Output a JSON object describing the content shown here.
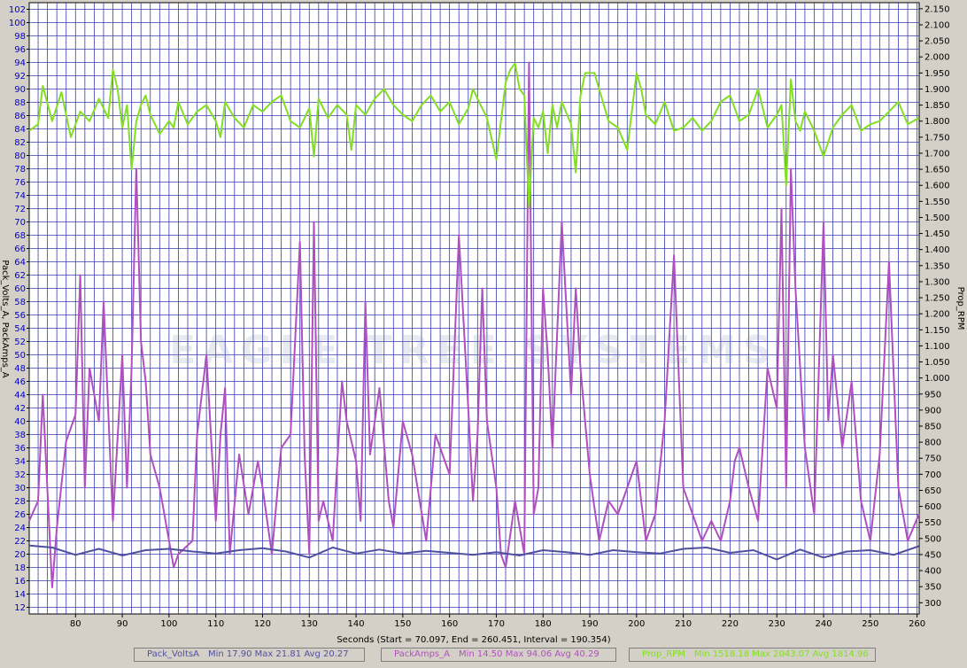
{
  "chart_data": {
    "type": "line",
    "xlabel": "Seconds (Start = 70.097,  End = 260.451,  Interval = 190.354)",
    "xlim": [
      70.097,
      260.451
    ],
    "x_ticks": [
      80,
      90,
      100,
      110,
      120,
      130,
      140,
      150,
      160,
      170,
      180,
      190,
      200,
      210,
      220,
      230,
      240,
      250,
      260
    ],
    "y_left": {
      "label": "Pack_Volts_A, PackAmps_A",
      "ylim": [
        11,
        103
      ],
      "ticks": [
        12,
        14,
        16,
        18,
        20,
        22,
        24,
        26,
        28,
        30,
        32,
        34,
        36,
        38,
        40,
        42,
        44,
        46,
        48,
        50,
        52,
        54,
        56,
        58,
        60,
        62,
        64,
        66,
        68,
        70,
        72,
        74,
        76,
        78,
        80,
        82,
        84,
        86,
        88,
        90,
        92,
        94,
        96,
        98,
        100,
        102
      ]
    },
    "y_right": {
      "label": "Prop_RPM",
      "ylim": [
        265,
        2169
      ],
      "ticks": [
        "300",
        "350",
        "400",
        "450",
        "500",
        "550",
        "600",
        "650",
        "700",
        "750",
        "800",
        "850",
        "900",
        "950",
        "1.000",
        "1.050",
        "1.100",
        "1.150",
        "1.200",
        "1.250",
        "1.300",
        "1.350",
        "1.400",
        "1.450",
        "1.500",
        "1.550",
        "1.600",
        "1.650",
        "1.700",
        "1.750",
        "1.800",
        "1.850",
        "1.900",
        "1.950",
        "2.000",
        "2.050",
        "2.100",
        "2.150"
      ]
    },
    "grid": true,
    "watermark": "EAGLE TREE SYSTEMS",
    "series": [
      {
        "name": "Pack_VoltsA",
        "axis": "left",
        "color": "#5050a0",
        "x": [
          70.1,
          75,
          80,
          85,
          90,
          95,
          100,
          105,
          110,
          115,
          120,
          125,
          130,
          135,
          140,
          145,
          150,
          155,
          160,
          165,
          170,
          175,
          180,
          185,
          190,
          195,
          200,
          205,
          210,
          215,
          220,
          225,
          230,
          235,
          240,
          245,
          250,
          255,
          260.4
        ],
        "y": [
          21.3,
          21.0,
          19.9,
          20.8,
          19.8,
          20.6,
          20.8,
          20.4,
          20.1,
          20.6,
          20.9,
          20.4,
          19.5,
          21.0,
          20.1,
          20.7,
          20.1,
          20.5,
          20.2,
          19.9,
          20.3,
          19.8,
          20.6,
          20.3,
          19.9,
          20.6,
          20.3,
          20.1,
          20.8,
          21.0,
          20.2,
          20.6,
          19.2,
          20.7,
          19.5,
          20.4,
          20.6,
          19.9,
          21.2
        ]
      },
      {
        "name": "PackAmps_A",
        "axis": "left",
        "color": "#b050c0",
        "x": [
          70.1,
          72,
          73,
          75,
          76,
          78,
          80,
          81,
          82,
          83,
          85,
          86,
          88,
          90,
          91,
          92,
          93,
          94,
          95,
          96,
          98,
          100,
          101,
          102,
          105,
          106,
          108,
          110,
          111,
          112,
          113,
          115,
          117,
          119,
          120,
          122,
          124,
          126,
          128,
          129,
          130,
          131,
          132,
          133,
          135,
          137,
          138,
          140,
          141,
          142,
          143,
          145,
          147,
          148,
          150,
          152,
          155,
          157,
          160,
          162,
          164,
          165,
          166,
          167,
          168,
          170,
          171,
          172,
          174,
          176,
          177,
          178,
          179,
          180,
          181,
          182,
          184,
          186,
          187,
          188,
          190,
          192,
          194,
          196,
          198,
          200,
          202,
          204,
          206,
          208,
          210,
          212,
          214,
          216,
          218,
          220,
          221,
          222,
          224,
          226,
          228,
          230,
          231,
          232,
          233,
          234,
          236,
          238,
          240,
          241,
          242,
          244,
          246,
          248,
          250,
          252,
          254,
          256,
          258,
          260.4
        ],
        "y": [
          25,
          28,
          44,
          15,
          24,
          37,
          41,
          62,
          30,
          48,
          40,
          58,
          25,
          50,
          30,
          48,
          78,
          52,
          46,
          35,
          30,
          22,
          18,
          20,
          22,
          38,
          50,
          25,
          38,
          45,
          20,
          35,
          26,
          34,
          30,
          20,
          36,
          38,
          67,
          35,
          20,
          70,
          25,
          28,
          22,
          46,
          40,
          34,
          25,
          58,
          35,
          45,
          28,
          24,
          40,
          35,
          22,
          38,
          32,
          68,
          42,
          28,
          38,
          60,
          40,
          30,
          20,
          18,
          28,
          20,
          94,
          26,
          30,
          60,
          50,
          36,
          70,
          44,
          60,
          48,
          32,
          22,
          28,
          26,
          30,
          34,
          22,
          26,
          40,
          65,
          30,
          26,
          22,
          25,
          22,
          28,
          34,
          36,
          30,
          25,
          48,
          42,
          72,
          30,
          78,
          60,
          36,
          26,
          70,
          40,
          50,
          36,
          46,
          28,
          22,
          35,
          64,
          30,
          22,
          26
        ]
      },
      {
        "name": "Prop_RPM",
        "axis": "right",
        "color": "#80e020",
        "x": [
          70.1,
          72,
          73,
          75,
          77,
          79,
          81,
          83,
          85,
          87,
          88,
          89,
          90,
          91,
          92,
          93,
          94,
          95,
          96,
          98,
          100,
          101,
          102,
          104,
          106,
          108,
          110,
          111,
          112,
          114,
          116,
          118,
          120,
          122,
          124,
          126,
          128,
          130,
          131,
          132,
          134,
          136,
          138,
          139,
          140,
          142,
          144,
          146,
          148,
          150,
          152,
          154,
          156,
          158,
          160,
          162,
          164,
          165,
          166,
          168,
          170,
          172,
          173,
          174,
          175,
          176,
          177,
          178,
          179,
          180,
          181,
          182,
          183,
          184,
          186,
          187,
          188,
          189,
          190,
          191,
          192,
          194,
          196,
          198,
          200,
          201,
          202,
          204,
          206,
          208,
          210,
          212,
          214,
          216,
          218,
          220,
          222,
          224,
          226,
          228,
          230,
          231,
          232,
          233,
          234,
          235,
          236,
          238,
          240,
          242,
          244,
          246,
          248,
          250,
          252,
          254,
          256,
          258,
          260.4
        ],
        "y": [
          1770,
          1790,
          1910,
          1800,
          1890,
          1750,
          1830,
          1800,
          1870,
          1810,
          1960,
          1900,
          1780,
          1850,
          1650,
          1800,
          1850,
          1880,
          1820,
          1760,
          1800,
          1780,
          1860,
          1790,
          1830,
          1850,
          1800,
          1750,
          1860,
          1810,
          1780,
          1850,
          1830,
          1860,
          1880,
          1800,
          1780,
          1840,
          1690,
          1870,
          1810,
          1850,
          1820,
          1710,
          1850,
          1820,
          1870,
          1900,
          1850,
          1820,
          1800,
          1850,
          1880,
          1830,
          1860,
          1790,
          1840,
          1900,
          1870,
          1810,
          1680,
          1920,
          1960,
          1980,
          1900,
          1880,
          1530,
          1810,
          1780,
          1830,
          1700,
          1850,
          1780,
          1860,
          1790,
          1640,
          1880,
          1950,
          1950,
          1950,
          1900,
          1800,
          1780,
          1710,
          1950,
          1900,
          1820,
          1790,
          1860,
          1770,
          1780,
          1810,
          1770,
          1800,
          1860,
          1880,
          1800,
          1820,
          1900,
          1780,
          1820,
          1850,
          1600,
          1930,
          1800,
          1770,
          1830,
          1770,
          1690,
          1780,
          1820,
          1850,
          1770,
          1790,
          1800,
          1830,
          1860,
          1790,
          1810
        ]
      }
    ],
    "legend": [
      {
        "name": "Pack_VoltsA",
        "stats": "Min 17.90   Max 21.81   Avg 20.27",
        "color": "#5050a0"
      },
      {
        "name": "PackAmps_A",
        "stats": "Min 14.50   Max 94.06   Avg 40.29",
        "color": "#b050c0"
      },
      {
        "name": "Prop_RPM",
        "stats": "Min 1518.18   Max 2043.07   Avg 1814.96",
        "color": "#80e020"
      }
    ]
  }
}
